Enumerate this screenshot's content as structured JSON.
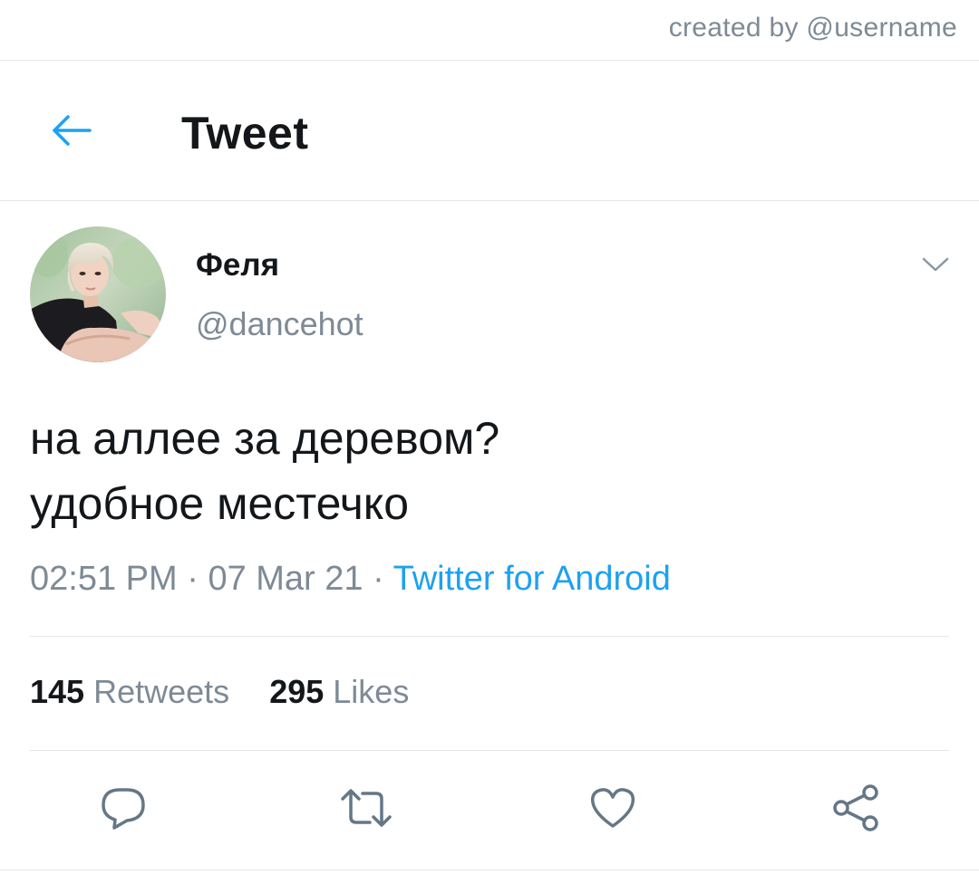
{
  "watermark": "created by @username",
  "header": {
    "title": "Tweet",
    "back_icon": "arrow-left-icon"
  },
  "tweet": {
    "user": {
      "name": "Феля",
      "handle": "@dancehot"
    },
    "text_lines": [
      "на аллее за деревом?",
      "удобное местечко"
    ],
    "time": "02:51 PM",
    "date": "07 Mar 21",
    "separator": "·",
    "source": "Twitter for Android",
    "stats": {
      "retweets_count": "145",
      "retweets_label": "Retweets",
      "likes_count": "295",
      "likes_label": "Likes"
    }
  },
  "icons": {
    "caret": "chevron-down-icon",
    "reply": "reply-icon",
    "retweet": "retweet-icon",
    "like": "heart-icon",
    "share": "share-icon"
  },
  "colors": {
    "accent": "#1da1f2",
    "text_primary": "#14171a",
    "text_secondary": "#7e8a95",
    "divider": "#e3e7ea"
  }
}
